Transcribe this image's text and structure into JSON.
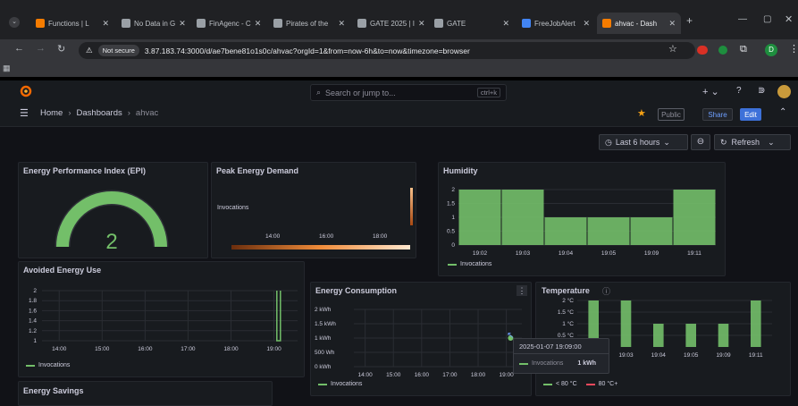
{
  "browser": {
    "tabs": [
      {
        "label": "Functions | L",
        "color": "#f57c00"
      },
      {
        "label": "No Data in G",
        "color": "#9aa0a6"
      },
      {
        "label": "FinAgenc - C",
        "color": "#9aa0a6"
      },
      {
        "label": "Pirates of the",
        "color": "#9aa0a6"
      },
      {
        "label": "GATE 2025 | I",
        "color": "#9aa0a6"
      },
      {
        "label": "GATE",
        "color": "#9aa0a6"
      },
      {
        "label": "FreeJobAlert",
        "color": "#4285f4"
      },
      {
        "label": "ahvac - Dash",
        "color": "#f57c00"
      }
    ],
    "not_secure": "Not secure",
    "url": "3.87.183.74:3000/d/ae7bene81o1s0c/ahvac?orgId=1&from=now-6h&to=now&timezone=browser",
    "profile_initial": "D"
  },
  "topnav": {
    "search_placeholder": "Search or jump to...",
    "shortcut": "ctrl+k"
  },
  "breadcrumb": {
    "home": "Home",
    "dashboards": "Dashboards",
    "current": "ahvac"
  },
  "actions": {
    "public": "Public",
    "share": "Share",
    "edit": "Edit"
  },
  "toolbar": {
    "time_range": "Last 6 hours",
    "refresh": "Refresh"
  },
  "panels": {
    "epi": {
      "title": "Energy Performance Index (EPI)",
      "value": "2",
      "gauge_fraction": 1.0,
      "color": "#73bf69"
    },
    "peak": {
      "title": "Peak Energy Demand",
      "row_label": "Invocations",
      "ticks": [
        "14:00",
        "16:00",
        "18:00"
      ]
    },
    "humidity": {
      "title": "Humidity",
      "legend": "Invocations"
    },
    "avoided": {
      "title": "Avoided Energy Use",
      "legend": "Invocations"
    },
    "consumption": {
      "title": "Energy Consumption",
      "legend": "Invocations",
      "tooltip": {
        "time": "2025-01-07 19:09:00",
        "series": "Invocations",
        "value": "1 kWh"
      }
    },
    "temperature": {
      "title": "Temperature",
      "legend_low": "< 80 °C",
      "legend_high": "80 °C+"
    },
    "savings": {
      "title": "Energy Savings"
    }
  },
  "chart_data": [
    {
      "type": "bar",
      "title": "Humidity",
      "categories": [
        "19:02",
        "19:03",
        "19:04",
        "19:05",
        "19:09",
        "19:11"
      ],
      "series": [
        {
          "name": "Invocations",
          "values": [
            2,
            2,
            1,
            1,
            1,
            2
          ]
        }
      ],
      "yticks": [
        "0",
        "0.5",
        "1",
        "1.5",
        "2"
      ],
      "ylim": [
        0,
        2
      ],
      "color": "#73bf69"
    },
    {
      "type": "line",
      "title": "Avoided Energy Use",
      "x": [
        "14:00",
        "15:00",
        "16:00",
        "17:00",
        "18:00",
        "19:00"
      ],
      "yticks": [
        "1",
        "1.2",
        "1.4",
        "1.6",
        "1.8",
        "2"
      ],
      "ylim": [
        1,
        2
      ],
      "series": [
        {
          "name": "Invocations",
          "points": [
            [
              "19:04",
              2
            ],
            [
              "19:04",
              1
            ],
            [
              "19:09",
              1
            ],
            [
              "19:09",
              2
            ]
          ]
        }
      ],
      "color": "#73bf69"
    },
    {
      "type": "line",
      "title": "Energy Consumption",
      "x": [
        "14:00",
        "15:00",
        "16:00",
        "17:00",
        "18:00",
        "19:00"
      ],
      "yticks": [
        "0 kWh",
        "500 Wh",
        "1 kWh",
        "1.5 kWh",
        "2 kWh"
      ],
      "ylim": [
        0,
        2
      ],
      "series": [
        {
          "name": "Invocations",
          "points": [
            [
              "19:09",
              1
            ]
          ]
        }
      ],
      "color": "#73bf69"
    },
    {
      "type": "bar",
      "title": "Temperature",
      "categories": [
        "19:02",
        "19:03",
        "19:04",
        "19:05",
        "19:09",
        "19:11"
      ],
      "series": [
        {
          "name": "< 80 °C",
          "values": [
            2,
            2,
            1,
            1,
            1,
            2
          ]
        }
      ],
      "yticks": [
        "0.5 °C",
        "1 °C",
        "1.5 °C",
        "2 °C"
      ],
      "ylim": [
        0,
        2
      ],
      "color": "#73bf69"
    }
  ]
}
